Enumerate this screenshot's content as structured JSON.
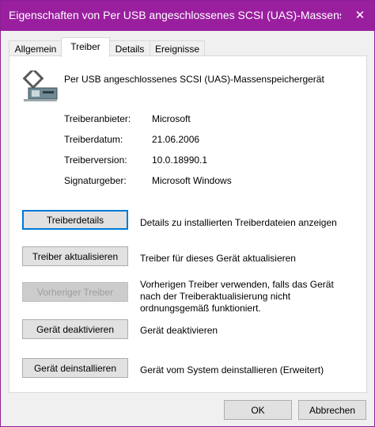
{
  "window": {
    "title": "Eigenschaften von Per USB angeschlossenes SCSI (UAS)-Massensp...",
    "close_glyph": "✕",
    "accent_color": "#9a1f9f"
  },
  "tabs": [
    {
      "label": "Allgemein",
      "active": false
    },
    {
      "label": "Treiber",
      "active": true
    },
    {
      "label": "Details",
      "active": false
    },
    {
      "label": "Ereignisse",
      "active": false
    }
  ],
  "device": {
    "icon": "usb-storage-device-icon",
    "name": "Per USB angeschlossenes SCSI (UAS)-Massenspeichergerät"
  },
  "properties": [
    {
      "label": "Treiberanbieter:",
      "value": "Microsoft"
    },
    {
      "label": "Treiberdatum:",
      "value": "21.06.2006"
    },
    {
      "label": "Treiberversion:",
      "value": "10.0.18990.1"
    },
    {
      "label": "Signaturgeber:",
      "value": "Microsoft Windows"
    }
  ],
  "actions": [
    {
      "label": "Treiberdetails",
      "description": "Details zu installierten Treiberdateien anzeigen",
      "enabled": true
    },
    {
      "label": "Treiber aktualisieren",
      "description": "Treiber für dieses Gerät aktualisieren",
      "enabled": true
    },
    {
      "label": "Vorheriger Treiber",
      "description": "Vorherigen Treiber verwenden, falls das Gerät nach der Treiberaktualisierung nicht ordnungsgemäß funktioniert.",
      "enabled": false
    },
    {
      "label": "Gerät deaktivieren",
      "description": "Gerät deaktivieren",
      "enabled": true
    },
    {
      "label": "Gerät deinstallieren",
      "description": "Gerät vom System deinstallieren (Erweitert)",
      "enabled": true
    }
  ],
  "footer": {
    "ok_label": "OK",
    "cancel_label": "Abbrechen"
  }
}
